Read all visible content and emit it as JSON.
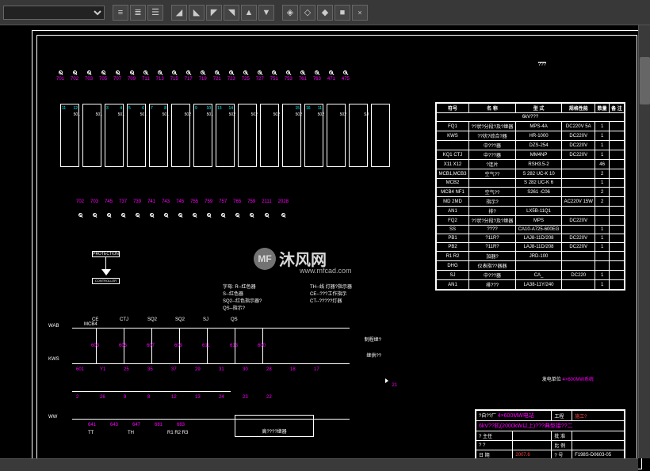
{
  "toolbar": {
    "dropdown_value": "",
    "buttons": [
      "align-left",
      "align-center",
      "align-right",
      "sep",
      "annot-1",
      "annot-2",
      "annot-3",
      "annot-4",
      "annot-5",
      "annot-6",
      "sep",
      "layer-1",
      "layer-2",
      "layer-3",
      "layer-4",
      "close"
    ]
  },
  "terminals_top": [
    {
      "n": "701"
    },
    {
      "n": "702"
    },
    {
      "n": "703"
    },
    {
      "n": "705"
    },
    {
      "n": "707"
    },
    {
      "n": "709"
    },
    {
      "n": "711"
    },
    {
      "n": "713"
    },
    {
      "n": "715"
    },
    {
      "n": "717"
    },
    {
      "n": "719"
    },
    {
      "n": "721"
    },
    {
      "n": "723"
    },
    {
      "n": "725"
    },
    {
      "n": "727"
    },
    {
      "n": "751"
    },
    {
      "n": "753"
    },
    {
      "n": "761"
    },
    {
      "n": "763"
    },
    {
      "n": "471"
    },
    {
      "n": "475"
    }
  ],
  "terminals_bot": [
    {
      "n": "702"
    },
    {
      "n": "703"
    },
    {
      "n": "745"
    },
    {
      "n": "737"
    },
    {
      "n": "739"
    },
    {
      "n": "741"
    },
    {
      "n": "743"
    },
    {
      "n": "745"
    },
    {
      "n": "755"
    },
    {
      "n": "759"
    },
    {
      "n": "757"
    },
    {
      "n": "765"
    },
    {
      "n": "759"
    },
    {
      "n": "2111"
    },
    {
      "n": "2028"
    }
  ],
  "wire_boxes": [
    {
      "l": "11",
      "r": "12",
      "s": "501"
    },
    {
      "l": "",
      "r": "",
      "s": "501"
    },
    {
      "l": "3",
      "r": "4",
      "s": "501"
    },
    {
      "l": "5",
      "r": "6",
      "s": "501"
    },
    {
      "l": "7",
      "r": "8",
      "s": "501"
    },
    {
      "l": "",
      "r": "",
      "s": "502"
    },
    {
      "l": "9",
      "r": "10",
      "s": "501"
    },
    {
      "l": "13",
      "r": "14",
      "s": "502"
    },
    {
      "l": "",
      "r": "",
      "s": "502"
    },
    {
      "l": "",
      "r": "",
      "s": "502"
    },
    {
      "l": "",
      "r": "15",
      "s": "502"
    },
    {
      "l": "16",
      "r": "11",
      "s": "502"
    },
    {
      "l": "",
      "r": "",
      "s": "502"
    },
    {
      "l": "",
      "r": "",
      "s": "SJ"
    },
    {
      "l": "",
      "r": "",
      "s": ""
    }
  ],
  "legend": {
    "line1": "字母: R--红色器",
    "line2": "S--红色器",
    "line3": "SQ2--红色指示器?",
    "line4": "QS--指示?",
    "line5": "TH--线 灯器?指示器",
    "line6": "CE--???工作指示",
    "line7": "CT--?????灯器"
  },
  "lower_label1": "WAB",
  "lower_label2": "KWS",
  "lower_label3": "WW",
  "lower_mcb": "MCB4",
  "lower_nums_top": [
    "603",
    "605",
    "607",
    "609",
    "611",
    "613",
    "600"
  ],
  "lower_nums_mid": [
    "601",
    "Y1",
    "25",
    "35",
    "37",
    "29",
    "31",
    "30",
    "28",
    "18",
    "17"
  ],
  "lower_nums_bot": [
    "2",
    "26",
    "9",
    "8",
    "12",
    "13",
    "24",
    "23",
    "22"
  ],
  "lower_nums_far": [
    "641",
    "643",
    "647",
    "681",
    "683"
  ],
  "lower_comps": [
    "CE",
    "CTJ",
    "SQ2",
    "SQ2",
    "SJ",
    "QS"
  ],
  "lower_tb": [
    "TT",
    "TH",
    "R1 R2 R3"
  ],
  "lower_box_text": "高????继器",
  "lower_right1": "制程继?",
  "lower_right2": "继供??",
  "lower_far_right": "21",
  "table_header_text": "???",
  "parts": {
    "headers": [
      "符号",
      "名 称",
      "型 式",
      "规格性能",
      "数量",
      "备 注"
    ],
    "category": "6kV???",
    "rows": [
      {
        "sym": "FQ1",
        "name": "??状?分段?及?继器",
        "model": "MPS-4A",
        "spec": "DC220V 5A",
        "qty": "1",
        "note": ""
      },
      {
        "sym": "KWS",
        "name": "??状?综合?器",
        "model": "HR-1000",
        "spec": "DC220V",
        "qty": "1",
        "note": ""
      },
      {
        "sym": "",
        "name": "中???器",
        "model": "DZS-254",
        "spec": "DC220V",
        "qty": "1",
        "note": ""
      },
      {
        "sym": "KQ1  CTJ",
        "name": "中???器",
        "model": "MM4NP",
        "spec": "DC220V",
        "qty": "1",
        "note": ""
      },
      {
        "sym": "X11   X12",
        "name": "?连片",
        "model": "RSH3.5-2",
        "spec": "",
        "qty": "46",
        "note": ""
      },
      {
        "sym": "MCB1,MCB3",
        "name": "空气??",
        "model": "S 282 UC-K 10",
        "spec": "",
        "qty": "2",
        "note": ""
      },
      {
        "sym": "MCB2",
        "name": "",
        "model": "S 282 UC-K 6",
        "spec": "",
        "qty": "1",
        "note": ""
      },
      {
        "sym": "MCB4  NF1",
        "name": "空气??",
        "model": "S261 -C06",
        "spec": "",
        "qty": "2",
        "note": ""
      },
      {
        "sym": "MD   2MD",
        "name": "指示?",
        "model": "",
        "spec": "AC220V  15W",
        "qty": "2",
        "note": ""
      },
      {
        "sym": "AN1",
        "name": "排?",
        "model": "LX5B-11Q1",
        "spec": "",
        "qty": "",
        "note": ""
      },
      {
        "sym": "FQ2",
        "name": "??状?分段?及?继器",
        "model": "MPS",
        "spec": "DC220V",
        "qty": "",
        "note": ""
      },
      {
        "sym": "SS",
        "name": "????",
        "model": "CA10-A725-600EG",
        "spec": "",
        "qty": "1",
        "note": ""
      },
      {
        "sym": "PB1",
        "name": "?11R?",
        "model": "LAJ8-11D/208",
        "spec": "DC220V",
        "qty": "1",
        "note": ""
      },
      {
        "sym": "PB2",
        "name": "?11R?",
        "model": "LAJ8-11D/208",
        "spec": "DC220V",
        "qty": "1",
        "note": ""
      },
      {
        "sym": "R1  R2",
        "name": "加器?",
        "model": "JRD-100",
        "spec": "",
        "qty": "",
        "note": ""
      },
      {
        "sym": "DHG",
        "name": "仪表指??器器",
        "model": "",
        "spec": "",
        "qty": "",
        "note": ""
      },
      {
        "sym": "SJ",
        "name": "中???器",
        "model": "CA_",
        "spec": "DC220",
        "qty": "1",
        "note": ""
      },
      {
        "sym": "AN1",
        "name": "排???",
        "model": "LA38-11Y/240",
        "spec": "",
        "qty": "1",
        "note": ""
      }
    ]
  },
  "title_block": {
    "header_left": "发电单位",
    "header_right": "4×600MW系统",
    "row1_left": "?自??厂",
    "row1_mid": "4×600MW电站",
    "row1_right_l": "工程",
    "row1_right_r": "施工?",
    "row2": "6kV??机(2000kW以上)???典型接??二",
    "row3_c1": "?  主任",
    "row3_c2": "批  准",
    "row4_c1": "?  ?",
    "row4_c2": "比  例",
    "row5_c1": "日  期",
    "row5_c2": "2007.6",
    "row5_c3": "?  号",
    "row5_c4": "F198S-D0603-05"
  },
  "watermark": {
    "text": "沐风网",
    "sub": "www.mfcad.com",
    "logo": "MF"
  },
  "chart_data": null
}
